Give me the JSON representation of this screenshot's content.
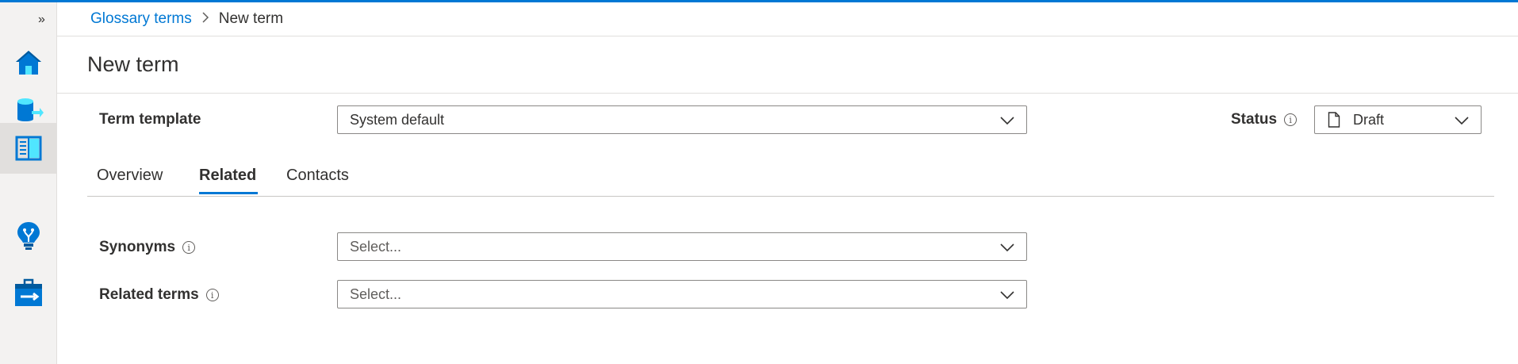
{
  "breadcrumb": {
    "parent": "Glossary terms",
    "current": "New term"
  },
  "page": {
    "title": "New term"
  },
  "rail": {
    "expand_glyph": "»",
    "items": [
      {
        "icon": "home-icon"
      },
      {
        "icon": "data-catalog-icon"
      },
      {
        "icon": "glossary-book-icon",
        "active": true
      },
      {
        "icon": "insights-bulb-icon"
      },
      {
        "icon": "management-toolbox-icon"
      }
    ]
  },
  "form": {
    "term_template": {
      "label": "Term template",
      "value": "System default"
    },
    "status": {
      "label": "Status",
      "info_glyph": "i",
      "value": "Draft",
      "icon": "document-icon"
    },
    "tabs": [
      {
        "label": "Overview",
        "selected": false
      },
      {
        "label": "Related",
        "selected": true
      },
      {
        "label": "Contacts",
        "selected": false
      }
    ],
    "synonyms": {
      "label": "Synonyms",
      "info_glyph": "i",
      "placeholder": "Select..."
    },
    "related_terms": {
      "label": "Related terms",
      "info_glyph": "i",
      "placeholder": "Select..."
    }
  },
  "colors": {
    "accent": "#0078d4",
    "rail_background": "#f3f2f1",
    "border": "#8a8886"
  }
}
